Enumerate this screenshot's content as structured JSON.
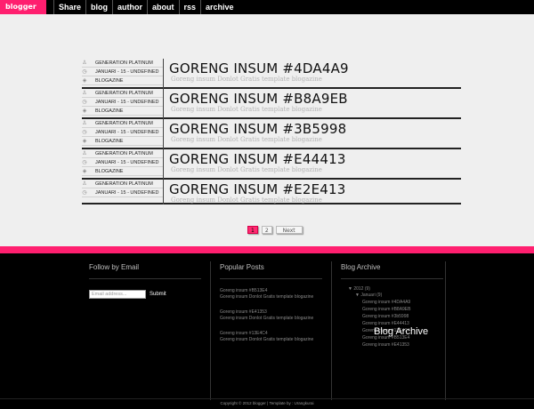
{
  "nav": {
    "brand": "blogger",
    "items": [
      "Share",
      "blog",
      "author",
      "about",
      "rss",
      "archive"
    ]
  },
  "posts": [
    {
      "author": "GENERATION PLATINUM",
      "date": "JANUARI - 15 - UNDEFINED",
      "label": "BLOGAZINE",
      "title": "GORENG INSUM #4DA4A9",
      "subtitle": "Goreng insum Donlot Gratis template blogazine"
    },
    {
      "author": "GENERATION PLATINUM",
      "date": "JANUARI - 15 - UNDEFINED",
      "label": "BLOGAZINE",
      "title": "GORENG INSUM #B8A9EB",
      "subtitle": "Goreng insum Donlot Gratis template blogazine"
    },
    {
      "author": "GENERATION PLATINUM",
      "date": "JANUARI - 15 - UNDEFINED",
      "label": "BLOGAZINE",
      "title": "GORENG INSUM #3B5998",
      "subtitle": "Goreng insum Donlot Gratis template blogazine"
    },
    {
      "author": "GENERATION PLATINUM",
      "date": "JANUARI - 15 - UNDEFINED",
      "label": "BLOGAZINE",
      "title": "GORENG INSUM #E44413",
      "subtitle": "Goreng insum Donlot Gratis template blogazine"
    },
    {
      "author": "GENERATION PLATINUM",
      "date": "JANUARI - 15 - UNDEFINED",
      "label": "",
      "title": "GORENG INSUM #E2E413",
      "subtitle": "Goreng insum Donlot Gratis template blogazine"
    }
  ],
  "pager": {
    "page1": "1",
    "page2": "2",
    "next": "Next"
  },
  "footer": {
    "follow_title": "Follow by Email",
    "email_placeholder": "Email address...",
    "submit": "Submit",
    "popular_title": "Popular Posts",
    "popular": [
      {
        "title": "Goreng insum #B513E4",
        "snippet": "Goreng insum Donlot Gratis template blogazine"
      },
      {
        "title": "Goreng insum #E41353",
        "snippet": "Goreng insum Donlot Gratis template blogazine"
      },
      {
        "title": "Goreng insum #13E4C4",
        "snippet": "Goreng insum Donlot Gratis template blogazine"
      }
    ],
    "archive_title": "Blog Archive",
    "archive_year": "▼  2012 (9)",
    "archive_month": "▼  Januari (9)",
    "archive_posts": [
      "Goreng insum #4DA4A9",
      "Goreng insum #B8A9EB",
      "Goreng insum #3b5998",
      "Goreng insum #E44413",
      "Goreng insum #13E4C4",
      "Goreng insum #B513E4",
      "Goreng insum #E41353"
    ],
    "archive_overlay": "Blog Archive",
    "copyright": "Copyright © 2012 blogger | Template by : Urangkurai"
  },
  "colors": {
    "accent": "#ff1f6f",
    "nav_bg": "#000000",
    "page_bg": "#efefef"
  }
}
